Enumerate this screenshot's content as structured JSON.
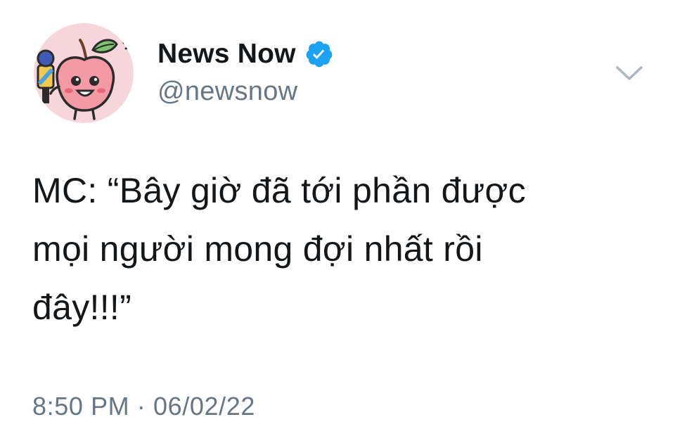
{
  "author": {
    "display_name": "News Now",
    "handle": "@newsnow",
    "verified_icon": "verified-badge-icon",
    "avatar_icon": "peach-reporter-mascot"
  },
  "menu": {
    "icon": "chevron-down-icon"
  },
  "tweet": {
    "lines": [
      "MC: “Bây giờ đã tới phần được",
      "mọi người mong đợi nhất rồi",
      "đây!!!”"
    ]
  },
  "meta": {
    "timestamp": "8:50 PM · 06/02/22"
  },
  "colors": {
    "text": "#14171a",
    "secondary": "#657786",
    "verified": "#1da1f2",
    "avatar_bg": "#f6d6da"
  }
}
